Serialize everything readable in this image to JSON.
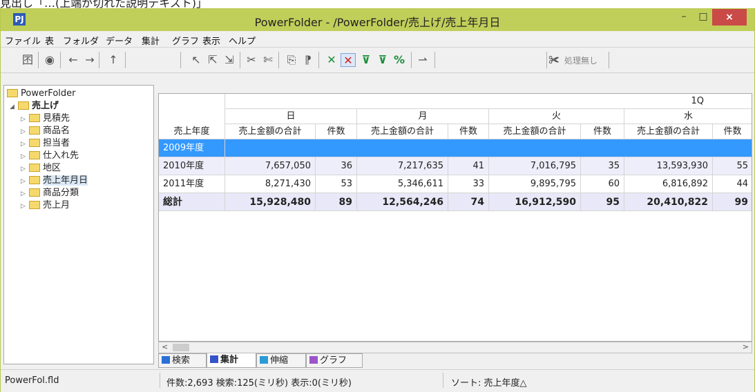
{
  "caption_fragment": "見出し「…(上端が切れた説明テキスト)」",
  "window": {
    "title": "PowerFolder - /PowerFolder/売上げ/売上年月日",
    "icon_text": "PJ",
    "minimize": "–",
    "maximize": "□",
    "close": "×"
  },
  "menu": [
    "ファイル",
    "表",
    "フォルダ",
    "データ",
    "集計",
    "グラフ",
    "表示",
    "ヘルプ"
  ],
  "toolbar": {
    "buttons": [
      {
        "name": "table-view-icon",
        "glyph": "囨"
      },
      {
        "name": "eye-icon",
        "glyph": "◉"
      },
      {
        "name": "back-arrow-icon",
        "glyph": "←"
      },
      {
        "name": "forward-arrow-icon",
        "glyph": "→"
      },
      {
        "name": "up-arrow-icon",
        "glyph": "↑"
      }
    ],
    "no_processing_label": "処理無し"
  },
  "tree": {
    "root": "PowerFolder",
    "folder": "売上げ",
    "items": [
      "見積先",
      "商品名",
      "担当者",
      "仕入れ先",
      "地区",
      "売上年月日",
      "商品分類",
      "売上月"
    ],
    "selected": "売上年月日"
  },
  "grid": {
    "top_header": "1Q",
    "days": [
      "日",
      "月",
      "火",
      "水"
    ],
    "row_header": "売上年度",
    "sum_label": "売上金額の合計",
    "count_label": "件数",
    "rows": [
      {
        "label": "2009年度",
        "cells": [
          "",
          "",
          "",
          "",
          "",
          "",
          "",
          ""
        ]
      },
      {
        "label": "2010年度",
        "cells": [
          "7,657,050",
          "36",
          "7,217,635",
          "41",
          "7,016,795",
          "35",
          "13,593,930",
          "55"
        ]
      },
      {
        "label": "2011年度",
        "cells": [
          "8,271,430",
          "53",
          "5,346,611",
          "33",
          "9,895,795",
          "60",
          "6,816,892",
          "44"
        ]
      },
      {
        "label": "総計",
        "cells": [
          "15,928,480",
          "89",
          "12,564,246",
          "74",
          "16,912,590",
          "95",
          "20,410,822",
          "99"
        ]
      }
    ]
  },
  "tabs": [
    {
      "label": "検索",
      "color": "#2a6fd6"
    },
    {
      "label": "集計",
      "color": "#3553c9"
    },
    {
      "label": "伸縮",
      "color": "#2a9bd6"
    },
    {
      "label": "グラフ",
      "color": "#9c55c9"
    }
  ],
  "status": {
    "file": "PowerFol.fld",
    "info": "件数:2,693 検索:125(ミリ秒) 表示:0(ミリ秒)",
    "sort": "ソート: 売上年度△"
  }
}
